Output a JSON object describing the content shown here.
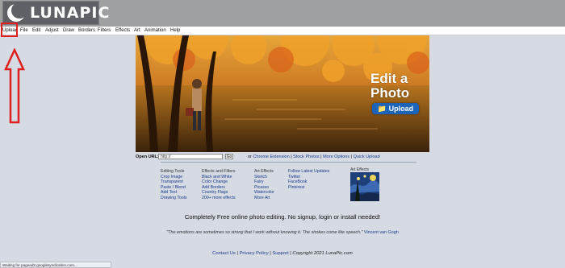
{
  "header": {
    "logo_text": "LUNAPIC"
  },
  "menu": [
    "Upload",
    "File",
    "Edit",
    "Adjust",
    "Draw",
    "Borders",
    "Filters",
    "Effects",
    "Art",
    "Animation",
    "Help"
  ],
  "hero": {
    "headline": "Edit a Photo",
    "upload_label": "Upload"
  },
  "url_row": {
    "label": "Open URL:",
    "input_value": "http://",
    "go_label": "Go",
    "or_text": "or",
    "links": [
      "Chrome Extension",
      "Stock Photos",
      "More Options",
      "Quick Upload"
    ],
    "separator": " | "
  },
  "columns": {
    "tools": [
      "Editing Tools",
      "Crop Image",
      "Transparent",
      "Paste / Blend",
      "Add Text",
      "Drawing Tools"
    ],
    "effects": [
      "Effects and Filters",
      "Black and White",
      "Color Change",
      "Add Borders",
      "Country Flags",
      "200+ more effects"
    ],
    "art": [
      "Art Effects",
      "Sketch",
      "Fairy",
      "Picasso",
      "Watercolor",
      "More Art"
    ],
    "social": [
      "Follow Latest Updates",
      "Twitter",
      "FaceBook",
      "Pinterest"
    ]
  },
  "art_effects_label": "Art Effects",
  "tagline": "Completely Free online photo editing. No signup, login or install needed!",
  "quote": {
    "text": "\"The emotions are sometimes so strong that I work without knowing it. The strokes come like speech.\"",
    "author": "Vincent van Gogh"
  },
  "footer": {
    "contact": "Contact Us",
    "privacy": "Privacy Policy",
    "support": "Support",
    "copyright": "Copyright 2021 LunaPic.com"
  },
  "status_text": "Waiting for pagead2.googlesyndication.com...",
  "colors": {
    "highlight": "#e01f1f",
    "link": "#1a3c8a",
    "upload_button": "#1c64b8"
  }
}
